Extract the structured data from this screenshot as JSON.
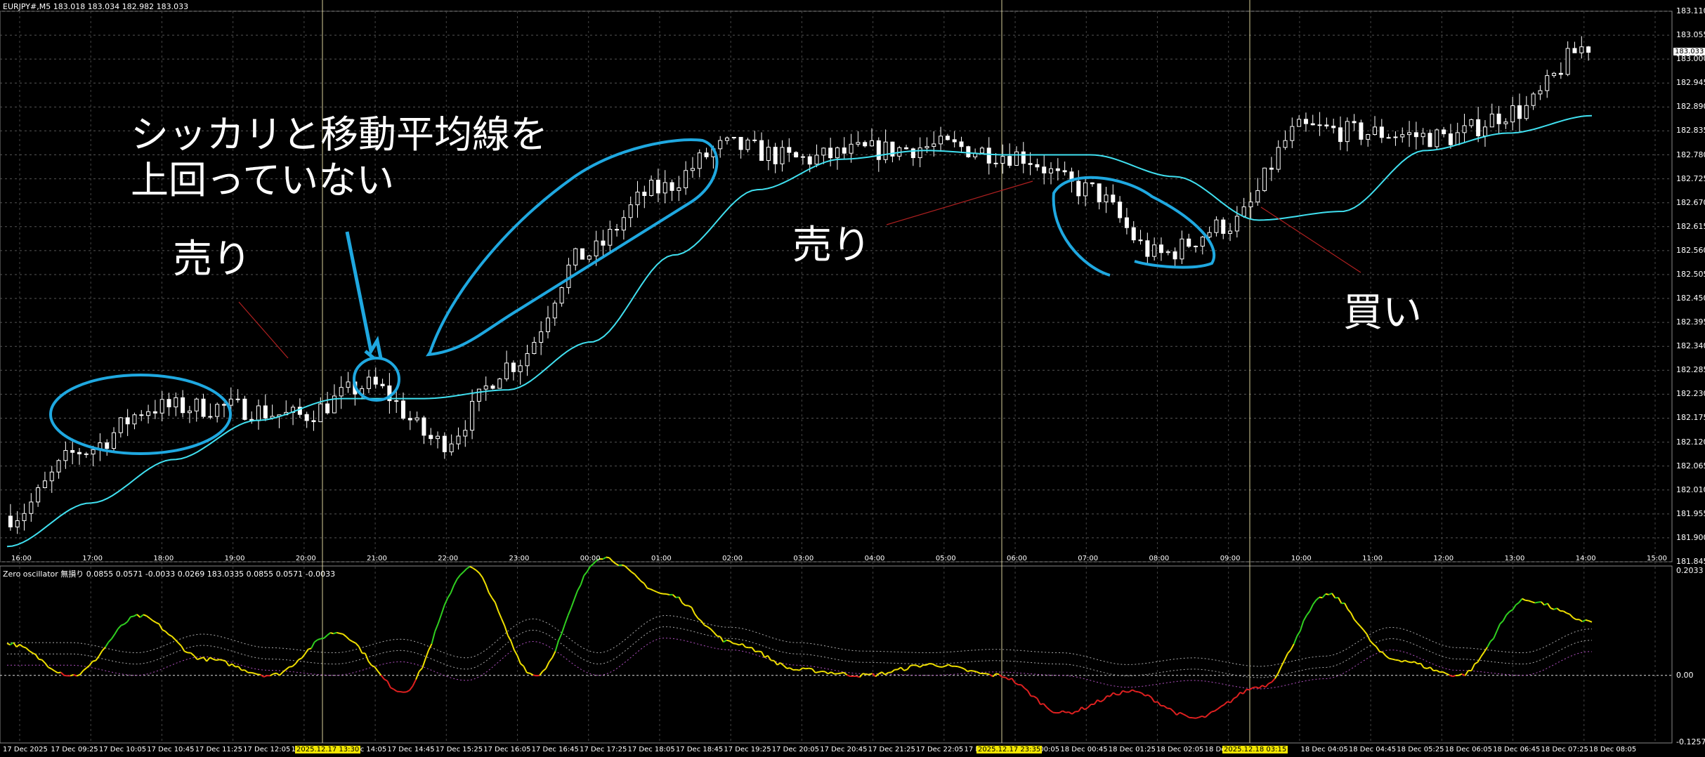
{
  "header": {
    "main_info": "EURJPY#,M5  183.018 183.034 182.982 183.033",
    "osc_info": "Zero oscillator 無損り 0.0855 0.0571 -0.0033 0.0269 183.0335 0.0855 0.0571 -0.0033"
  },
  "annotations": {
    "note_ma": "シッカリと移動平均線を\n上回っていない",
    "sell_1": "売り",
    "sell_2": "売り",
    "buy": "買い"
  },
  "price_axis": {
    "labels": [
      "183.110",
      "183.055",
      "183.000",
      "182.945",
      "182.890",
      "182.835",
      "182.780",
      "182.725",
      "182.670",
      "182.615",
      "182.560",
      "182.505",
      "182.450",
      "182.395",
      "182.340",
      "182.285",
      "182.230",
      "182.175",
      "182.120",
      "182.065",
      "182.010",
      "181.955",
      "181.900",
      "181.845"
    ],
    "current": "183.033"
  },
  "osc_axis": {
    "labels": [
      "0.2033",
      "0.00",
      "-0.1257"
    ]
  },
  "time_axis_top": {
    "labels": [
      "16:00",
      "17:00",
      "18:00",
      "19:00",
      "20:00",
      "21:00",
      "22:00",
      "23:00",
      "00:00",
      "01:00",
      "02:00",
      "03:00",
      "04:00",
      "05:00",
      "06:00",
      "07:00",
      "08:00",
      "09:00",
      "10:00",
      "11:00",
      "12:00",
      "13:00",
      "14:00",
      "15:00"
    ]
  },
  "time_axis_bottom": {
    "labels": [
      "17 Dec 2025",
      "17 Dec 09:25",
      "17 Dec 10:05",
      "17 Dec 10:45",
      "17 Dec 11:25",
      "17 Dec 12:05",
      "17 Dec 12:",
      "17 Dec 14:05",
      "17 Dec 14:45",
      "17 Dec 15:25",
      "17 Dec 16:05",
      "17 Dec 16:45",
      "17 Dec 17:25",
      "17 Dec 18:05",
      "17 Dec 18:45",
      "17 Dec 19:25",
      "17 Dec 20:05",
      "17 Dec 20:45",
      "17 Dec 21:25",
      "17 Dec 22:05",
      "17 Dec 2",
      "18 Dec 00:05",
      "18 Dec 00:45",
      "18 Dec 01:25",
      "18 Dec 02:05",
      "18 Dec",
      "03:25",
      "18 Dec 04:05",
      "18 Dec 04:45",
      "18 Dec 05:25",
      "18 Dec 06:05",
      "18 Dec 06:45",
      "18 Dec 07:25",
      "18 Dec 08:05"
    ],
    "highlights": [
      "2025.12.17 13:30",
      "2025.12.17 23:35",
      "2025.12.18 03:15"
    ]
  },
  "colors": {
    "background": "#000000",
    "candle": "#ffffff",
    "moving_average": "#40e0f0",
    "annotation_stroke": "#1fa8e0",
    "osc_up": "#30d020",
    "osc_neutral": "#f0e000",
    "osc_down": "#e02020",
    "vertical_marker": "#d8d09a"
  },
  "chart_data": [
    {
      "type": "candlestick",
      "symbol": "EURJPY#",
      "timeframe": "M5",
      "ylim": [
        181.845,
        183.11
      ],
      "ma_anchor_values": [
        181.88,
        181.98,
        182.08,
        182.17,
        182.22,
        182.22,
        182.24,
        182.35,
        182.55,
        182.7,
        182.77,
        182.79,
        182.78,
        182.78,
        182.73,
        182.63,
        182.65,
        182.79,
        182.83,
        182.87
      ],
      "price_anchor_values": [
        181.95,
        182.1,
        182.2,
        182.2,
        182.18,
        182.25,
        182.12,
        182.3,
        182.55,
        182.7,
        182.8,
        182.77,
        182.79,
        182.8,
        182.78,
        182.7,
        182.55,
        182.62,
        182.84,
        182.83,
        182.82,
        182.88,
        183.03
      ]
    },
    {
      "type": "line",
      "name": "Zero oscillator",
      "ylim": [
        -0.1257,
        0.2033
      ],
      "anchor_values": [
        0.06,
        0.0,
        0.11,
        0.03,
        0.0,
        0.08,
        -0.03,
        0.2,
        0.0,
        0.22,
        0.15,
        0.06,
        0.01,
        0.0,
        0.02,
        0.0,
        -0.07,
        -0.03,
        -0.08,
        -0.02,
        0.15,
        0.03,
        0.0,
        0.14,
        0.1
      ]
    }
  ]
}
